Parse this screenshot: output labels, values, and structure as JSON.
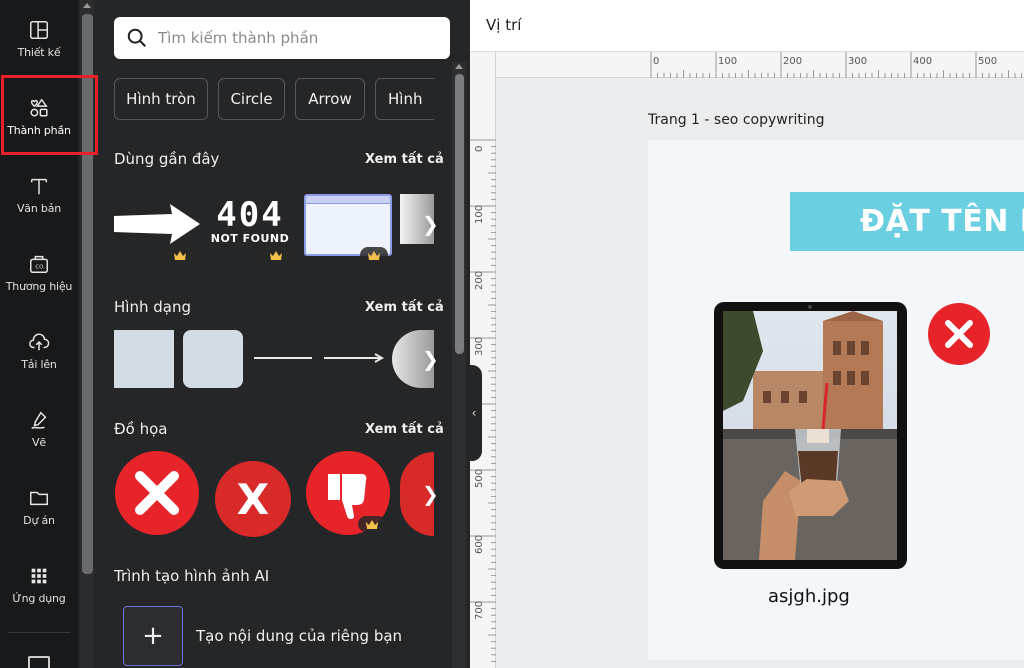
{
  "sidebar": {
    "items": [
      {
        "label": "Thiết kế",
        "icon": "layout-icon"
      },
      {
        "label": "Thành phần",
        "icon": "elements-icon"
      },
      {
        "label": "Văn bản",
        "icon": "text-icon"
      },
      {
        "label": "Thương hiệu",
        "icon": "brand-icon"
      },
      {
        "label": "Tải lên",
        "icon": "upload-cloud-icon"
      },
      {
        "label": "Vẽ",
        "icon": "draw-icon"
      },
      {
        "label": "Dự án",
        "icon": "folder-icon"
      },
      {
        "label": "Ứng dụng",
        "icon": "apps-grid-icon"
      }
    ],
    "active_index": 1
  },
  "panel": {
    "search_placeholder": "Tìm kiếm thành phần",
    "chips": [
      "Hình tròn",
      "Circle",
      "Arrow",
      "Hình"
    ],
    "recent": {
      "title": "Dùng gần đây",
      "see_all": "Xem tất cả",
      "not_found_big": "404",
      "not_found_small": "NOT FOUND"
    },
    "shapes": {
      "title": "Hình dạng",
      "see_all": "Xem tất cả"
    },
    "graphics": {
      "title": "Đồ họa",
      "see_all": "Xem tất cả"
    },
    "ai": {
      "title": "Trình tạo hình ảnh AI",
      "create_label": "Tạo nội dung của riêng bạn"
    }
  },
  "workspace": {
    "topbar_title": "Vị trí",
    "ruler_h": [
      "0",
      "100",
      "200",
      "300",
      "400",
      "500"
    ],
    "ruler_v": [
      "0",
      "100",
      "200",
      "300",
      "400",
      "500",
      "600",
      "700"
    ],
    "page_label": "Trang 1 - seo copywriting",
    "banner_text": "ĐẶT TÊN FILE",
    "filename": "asjgh.jpg"
  },
  "colors": {
    "highlight": "#e8202a",
    "banner": "#69cfe1",
    "graphic_red": "#e8242b"
  }
}
